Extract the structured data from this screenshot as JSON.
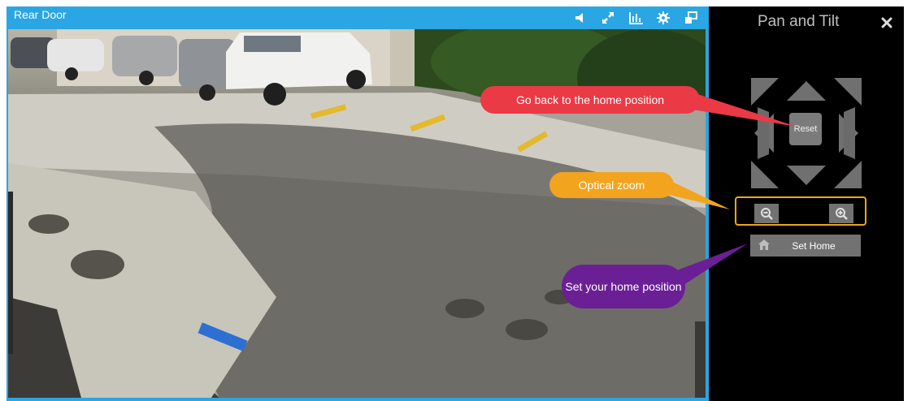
{
  "camera": {
    "title": "Rear Door",
    "icons": [
      "volume-icon",
      "fullscreen-icon",
      "stats-icon",
      "gear-icon",
      "popout-icon"
    ]
  },
  "ptz": {
    "title": "Pan and Tilt",
    "reset_label": "Reset",
    "set_home_label": "Set Home",
    "zoom_out_icon": "zoom-out-icon",
    "zoom_in_icon": "zoom-in-icon"
  },
  "callouts": {
    "home": "Go back to the home position",
    "zoom": "Optical zoom",
    "sethome": "Set your home position"
  },
  "colors": {
    "accent_blue": "#29a6e3",
    "panel_black": "#000000",
    "control_grey": "#7b7b7b",
    "callout_red": "#ea3a45",
    "callout_orange": "#f2a41f",
    "callout_purple": "#6b1f95"
  }
}
